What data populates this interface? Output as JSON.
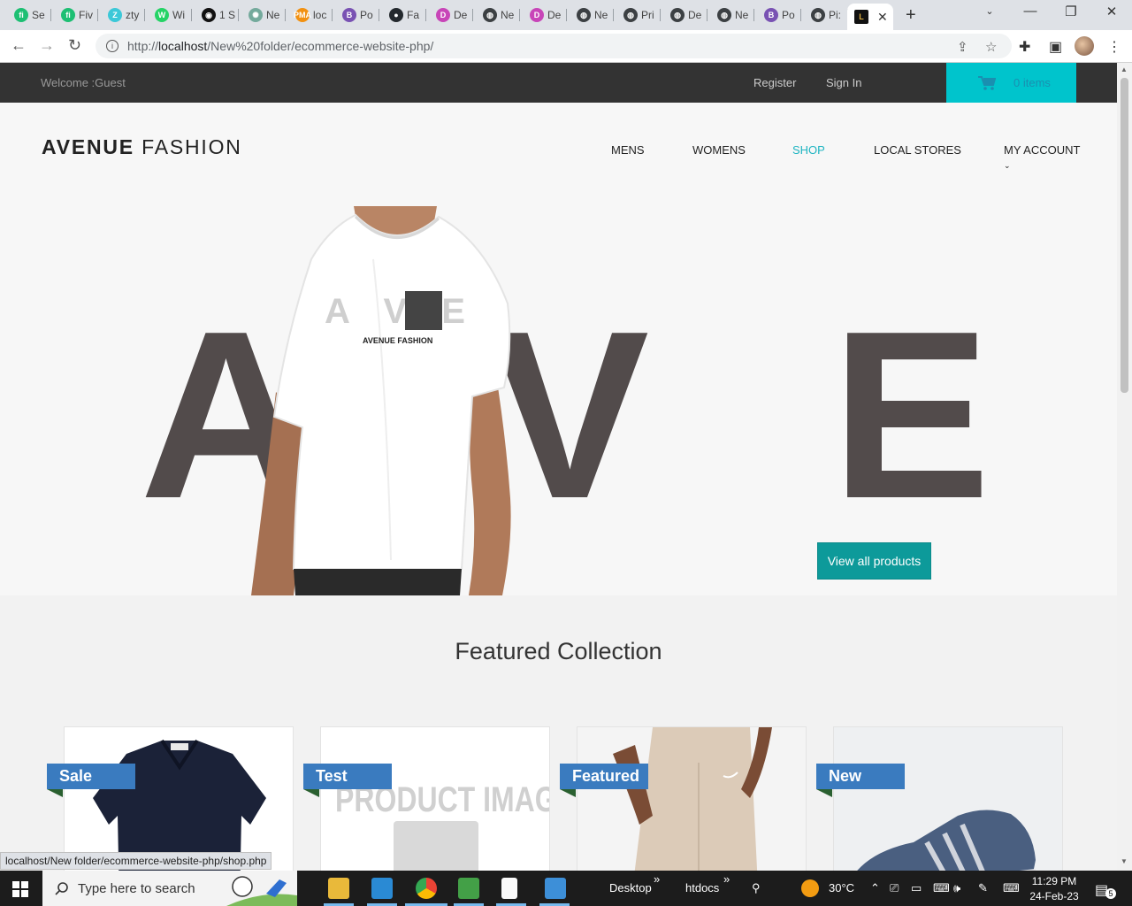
{
  "browser": {
    "tabs": [
      {
        "title": "Se",
        "icon": "fiverr-icon",
        "color": "#1dbf73",
        "glyph": "fi"
      },
      {
        "title": "Fiv",
        "icon": "fiverr-icon",
        "color": "#1dbf73",
        "glyph": "fi"
      },
      {
        "title": "zty",
        "icon": "zety-icon",
        "color": "#3cc8d8",
        "glyph": "Z"
      },
      {
        "title": "Wi",
        "icon": "whatsapp-icon",
        "color": "#25d366",
        "glyph": "W"
      },
      {
        "title": "1 S",
        "icon": "eye-icon",
        "color": "#111111",
        "glyph": "◉"
      },
      {
        "title": "Ne",
        "icon": "openai-icon",
        "color": "#74aa9c",
        "glyph": "✺"
      },
      {
        "title": "loc",
        "icon": "phpmyadmin-icon",
        "color": "#f29111",
        "glyph": "PMA"
      },
      {
        "title": "Po",
        "icon": "bootstrap-icon",
        "color": "#7952b3",
        "glyph": "B"
      },
      {
        "title": "Fa",
        "icon": "github-icon",
        "color": "#24292e",
        "glyph": "●"
      },
      {
        "title": "De",
        "icon": "dribbble-icon",
        "color": "#c845b8",
        "glyph": "D"
      },
      {
        "title": "Ne",
        "icon": "globe-icon",
        "color": "#3c4043",
        "glyph": "◍"
      },
      {
        "title": "De",
        "icon": "dribbble-icon",
        "color": "#c845b8",
        "glyph": "D"
      },
      {
        "title": "Ne",
        "icon": "globe-icon",
        "color": "#3c4043",
        "glyph": "◍"
      },
      {
        "title": "Pri",
        "icon": "globe-icon",
        "color": "#3c4043",
        "glyph": "◍"
      },
      {
        "title": "De",
        "icon": "globe-icon",
        "color": "#3c4043",
        "glyph": "◍"
      },
      {
        "title": "Ne",
        "icon": "globe-icon",
        "color": "#3c4043",
        "glyph": "◍"
      },
      {
        "title": "Po",
        "icon": "bootstrap-icon",
        "color": "#7952b3",
        "glyph": "B"
      },
      {
        "title": "Pi:",
        "icon": "globe-icon",
        "color": "#3c4043",
        "glyph": "◍"
      }
    ],
    "active_tab_glyph": "L",
    "url_prefix": "http://",
    "url_host": "localhost",
    "url_path": "/New%20folder/ecommerce-website-php/",
    "status_link": "localhost/New folder/ecommerce-website-php/shop.php"
  },
  "site": {
    "welcome": "Welcome :Guest",
    "register": "Register",
    "sign_in": "Sign In",
    "cart_items": "0 items",
    "logo_bold": "AVENUE",
    "logo_light": "FASHION",
    "nav": [
      "MENS",
      "WOMENS",
      "SHOP",
      "LOCAL STORES",
      "MY ACCOUNT"
    ],
    "active_nav": "SHOP",
    "hero_letters": [
      "A",
      "V",
      "E"
    ],
    "shirt_print": "AVENUE FASHION",
    "shirt_letters": "A V E",
    "view_all": "View all products",
    "featured_title": "Featured Collection",
    "products": [
      {
        "badge": "Sale",
        "image": "navy polo shirt"
      },
      {
        "badge": "Test",
        "image": "product image placeholder",
        "placeholder_text": "PRODUCT IMAGE"
      },
      {
        "badge": "Featured",
        "image": "beige sweatpants"
      },
      {
        "badge": "New",
        "image": "blue running shoe"
      }
    ],
    "colors": {
      "accent": "#00c4cc",
      "button": "#0d9a9a",
      "badge": "#3a7bbf",
      "topbar": "#333333",
      "hero_letter": "#524b4b"
    }
  },
  "taskbar": {
    "search_placeholder": "Type here to search",
    "desktop_label": "Desktop",
    "htdocs_label": "htdocs",
    "temperature": "30°C",
    "time": "11:29 PM",
    "date": "24-Feb-23",
    "notifications": "5"
  }
}
